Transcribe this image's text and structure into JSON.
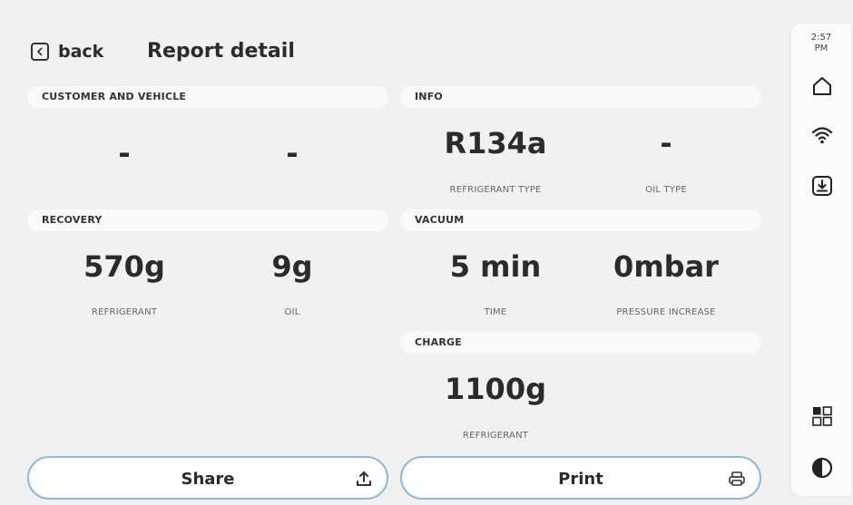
{
  "header": {
    "back_label": "back",
    "title": "Report detail"
  },
  "sections": {
    "customer": {
      "title": "CUSTOMER AND VEHICLE",
      "field1": "-",
      "field2": "-"
    },
    "info": {
      "title": "INFO",
      "refrigerant_type_value": "R134a",
      "refrigerant_type_label": "REFRIGERANT TYPE",
      "oil_type_value": "-",
      "oil_type_label": "OIL TYPE"
    },
    "recovery": {
      "title": "RECOVERY",
      "refrigerant_value": "570g",
      "refrigerant_label": "REFRIGERANT",
      "oil_value": "9g",
      "oil_label": "OIL"
    },
    "vacuum": {
      "title": "VACUUM",
      "time_value": "5 min",
      "time_label": "TIME",
      "pressure_value": "0mbar",
      "pressure_label": "PRESSURE INCREASE"
    },
    "charge": {
      "title": "CHARGE",
      "refrigerant_value": "1100g",
      "refrigerant_label": "REFRIGERANT"
    }
  },
  "actions": {
    "share_label": "Share",
    "print_label": "Print"
  },
  "rail": {
    "time": "2:57",
    "ampm": "PM"
  },
  "icons": {
    "back": "chevron-left-icon",
    "share": "upload-icon",
    "print": "printer-icon",
    "home": "home-icon",
    "wifi": "wifi-icon",
    "download": "download-icon",
    "apps": "grid-icon",
    "contrast": "contrast-icon"
  },
  "colors": {
    "background": "#f1f1f1",
    "button_border": "#8fb9d3",
    "text": "#2b2b2b"
  }
}
